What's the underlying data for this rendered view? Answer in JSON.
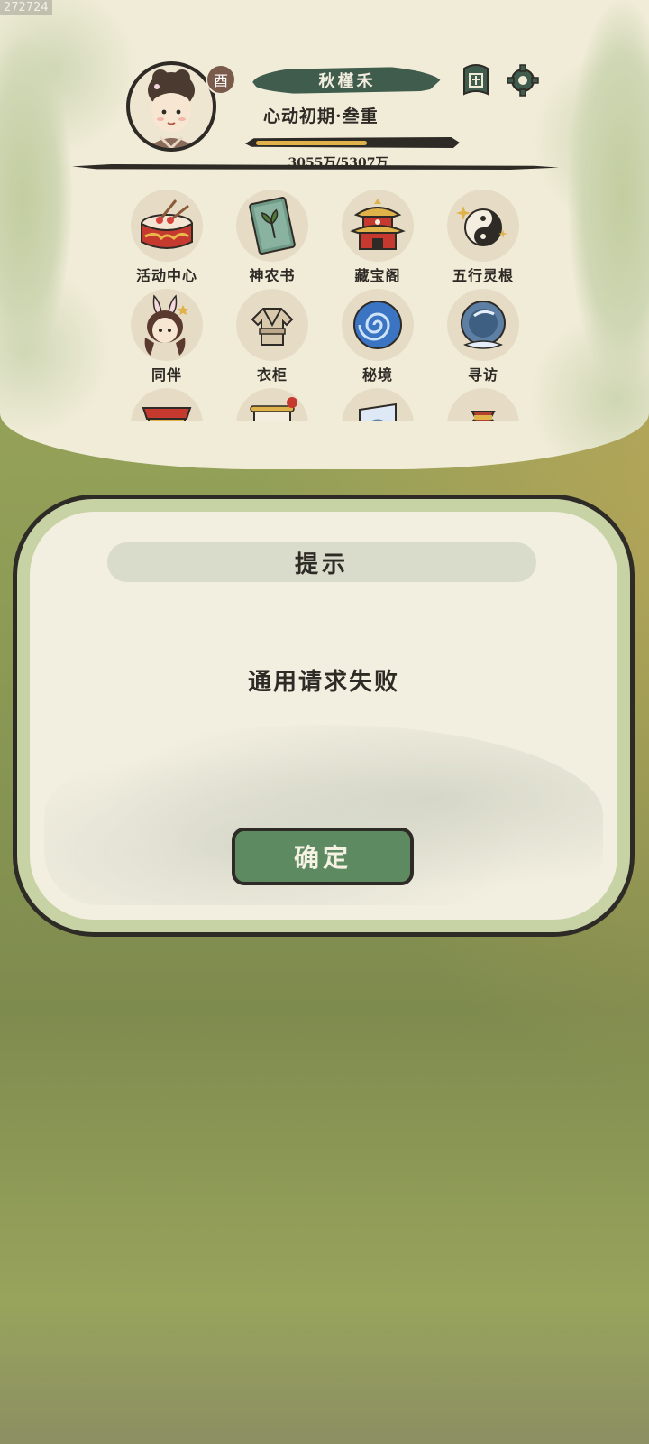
{
  "uid": "272724",
  "profile": {
    "zodiac": "酉",
    "name": "秋槿禾",
    "rank": "心动初期·叁重",
    "exp_text": "3055万/5307万",
    "exp_current": 3055,
    "exp_max": 5307
  },
  "menu": {
    "items": [
      {
        "label": "活动中心",
        "icon": "drum-icon"
      },
      {
        "label": "神农书",
        "icon": "herb-book-icon"
      },
      {
        "label": "藏宝阁",
        "icon": "pavilion-icon"
      },
      {
        "label": "五行灵根",
        "icon": "yin-yang-spirit-icon"
      },
      {
        "label": "同伴",
        "icon": "companion-icon"
      },
      {
        "label": "衣柜",
        "icon": "robe-icon"
      },
      {
        "label": "秘境",
        "icon": "vortex-icon"
      },
      {
        "label": "寻访",
        "icon": "crystal-orb-icon"
      },
      {
        "label": "",
        "icon": "stall-icon"
      },
      {
        "label": "",
        "icon": "scroll-icon"
      },
      {
        "label": "",
        "icon": "banner-icon"
      },
      {
        "label": "",
        "icon": "pouch-icon"
      }
    ]
  },
  "dialog": {
    "title": "提示",
    "message": "通用请求失败",
    "confirm_label": "确定"
  },
  "colors": {
    "ink": "#2e2a25",
    "paper": "#f1ecd8",
    "name_plate": "#3f5c4c",
    "exp": "#e0b24a",
    "button": "#5e8a62"
  }
}
